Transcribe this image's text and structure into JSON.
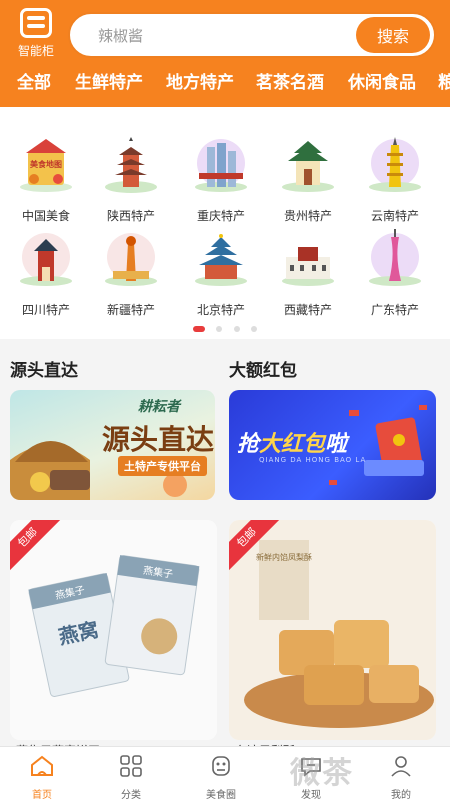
{
  "header": {
    "logo_text": "智能柜",
    "search_placeholder": "辣椒酱",
    "search_button": "搜索"
  },
  "tabs": [
    {
      "label": "全部",
      "active": true
    },
    {
      "label": "生鲜特产",
      "active": false
    },
    {
      "label": "地方特产",
      "active": false
    },
    {
      "label": "茗茶名酒",
      "active": false
    },
    {
      "label": "休闲食品",
      "active": false
    },
    {
      "label": "粮",
      "active": false
    }
  ],
  "regions": [
    {
      "label": "中国美食",
      "icon": "china-food-icon"
    },
    {
      "label": "陕西特产",
      "icon": "shaanxi-pagoda-icon"
    },
    {
      "label": "重庆特产",
      "icon": "chongqing-towers-icon"
    },
    {
      "label": "贵州特产",
      "icon": "guizhou-pavilion-icon"
    },
    {
      "label": "云南特产",
      "icon": "yunnan-pagoda-icon"
    },
    {
      "label": "四川特产",
      "icon": "sichuan-tower-icon"
    },
    {
      "label": "新疆特产",
      "icon": "xinjiang-tower-icon"
    },
    {
      "label": "北京特产",
      "icon": "beijing-temple-icon"
    },
    {
      "label": "西藏特产",
      "icon": "tibet-palace-icon"
    },
    {
      "label": "广东特产",
      "icon": "guangdong-tower-icon"
    }
  ],
  "china_food_badge": "美食地图",
  "sections": {
    "left_title": "源头直达",
    "right_title": "大额红包"
  },
  "banners": {
    "left_brand": "耕耘者",
    "left_main": "源头直达",
    "left_sub": "土特产专供平台",
    "right_main_a": "抢",
    "right_main_b": "大红包",
    "right_main_c": "啦",
    "right_pinyin": "QIANG DA HONG BAO LA"
  },
  "products": [
    {
      "badge": "包邮",
      "pack_brand": "燕集子",
      "pack_text": "燕窝",
      "title": "燕集子燕窝饼干 ..."
    },
    {
      "badge": "包邮",
      "box_text": "新鲜内馅凤梨酥",
      "title": "台湾凤梨酥 ..."
    }
  ],
  "bottom_nav": [
    {
      "label": "首页",
      "icon": "home-icon",
      "active": true
    },
    {
      "label": "分类",
      "icon": "category-grid-icon",
      "active": false
    },
    {
      "label": "美食圈",
      "icon": "food-circle-icon",
      "active": false
    },
    {
      "label": "发现",
      "icon": "discover-chat-icon",
      "active": false
    },
    {
      "label": "我的",
      "icon": "profile-icon",
      "active": false
    }
  ],
  "watermark": "微茶",
  "colors": {
    "brand": "#f6821f",
    "badge_red": "#e8343d",
    "dot_active": "#e83c3c"
  }
}
